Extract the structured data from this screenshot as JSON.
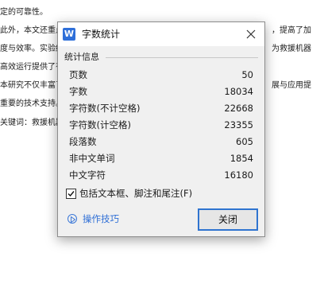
{
  "background": {
    "lines": [
      "定的可靠性。",
      "此外，本文还重点",
      "度与效率。实验结",
      "高效运行提供了有",
      "本研究不仅丰富了",
      "重要的技术支持。",
      "关键词：救援机器"
    ],
    "right_fragments": [
      "，提高了加",
      "为救援机器",
      "展与应用提"
    ]
  },
  "dialog": {
    "title": "字数统计",
    "app_icon_letter": "W",
    "group_title": "统计信息",
    "stats": [
      {
        "label": "页数",
        "value": "50"
      },
      {
        "label": "字数",
        "value": "18034"
      },
      {
        "label": "字符数(不计空格)",
        "value": "22668"
      },
      {
        "label": "字符数(计空格)",
        "value": "23355"
      },
      {
        "label": "段落数",
        "value": "605"
      },
      {
        "label": "非中文单词",
        "value": "1854"
      },
      {
        "label": "中文字符",
        "value": "16180"
      }
    ],
    "checkbox_label": "包括文本框、脚注和尾注(F)",
    "checkbox_checked": true,
    "tips_label": "操作技巧",
    "close_button_label": "关闭",
    "accent_color": "#2f74d0"
  }
}
